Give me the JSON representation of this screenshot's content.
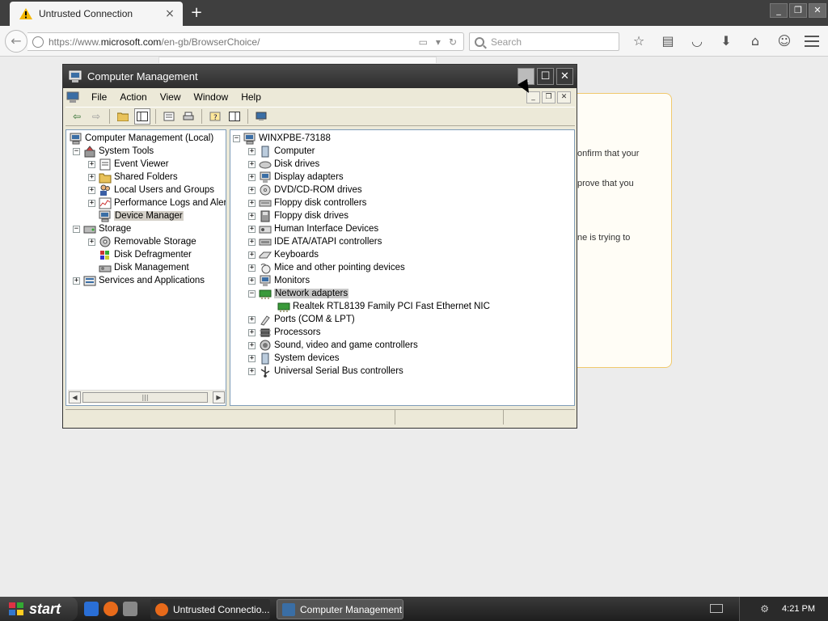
{
  "browser": {
    "tab_title": "Untrusted Connection",
    "tab_close": "×",
    "new_tab": "+",
    "url_prefix": "https://www.",
    "url_domain": "microsoft.com",
    "url_path": "/en-gb/BrowserChoice/",
    "search_placeholder": "Search",
    "window_buttons": {
      "min": "_",
      "restore": "❐",
      "close": "✕"
    }
  },
  "page": {
    "line1": "onfirm that your",
    "line2": "prove that you",
    "line3": "ne is trying to"
  },
  "cm_window": {
    "title": "Computer Management",
    "menu": [
      "File",
      "Action",
      "View",
      "Window",
      "Help"
    ]
  },
  "left_tree": [
    {
      "label": "Computer Management (Local)"
    },
    {
      "label": "System Tools"
    },
    {
      "label": "Event Viewer"
    },
    {
      "label": "Shared Folders"
    },
    {
      "label": "Local Users and Groups"
    },
    {
      "label": "Performance Logs and Alerts"
    },
    {
      "label": "Device Manager"
    },
    {
      "label": "Storage"
    },
    {
      "label": "Removable Storage"
    },
    {
      "label": "Disk Defragmenter"
    },
    {
      "label": "Disk Management"
    },
    {
      "label": "Services and Applications"
    }
  ],
  "right_tree": [
    {
      "label": "WINXPBE-73188"
    },
    {
      "label": "Computer"
    },
    {
      "label": "Disk drives"
    },
    {
      "label": "Display adapters"
    },
    {
      "label": "DVD/CD-ROM drives"
    },
    {
      "label": "Floppy disk controllers"
    },
    {
      "label": "Floppy disk drives"
    },
    {
      "label": "Human Interface Devices"
    },
    {
      "label": "IDE ATA/ATAPI controllers"
    },
    {
      "label": "Keyboards"
    },
    {
      "label": "Mice and other pointing devices"
    },
    {
      "label": "Monitors"
    },
    {
      "label": "Network adapters"
    },
    {
      "label": "Realtek RTL8139 Family PCI Fast Ethernet NIC"
    },
    {
      "label": "Ports (COM & LPT)"
    },
    {
      "label": "Processors"
    },
    {
      "label": "Sound, video and game controllers"
    },
    {
      "label": "System devices"
    },
    {
      "label": "Universal Serial Bus controllers"
    }
  ],
  "taskbar": {
    "start_label": "start",
    "task1": "Untrusted Connectio...",
    "task2": "Computer Management",
    "clock": "4:21 PM"
  },
  "colors": {
    "warning": "#f5b800",
    "title_bar": "#2e2e2e",
    "network_icon": "#3a9a3a"
  }
}
